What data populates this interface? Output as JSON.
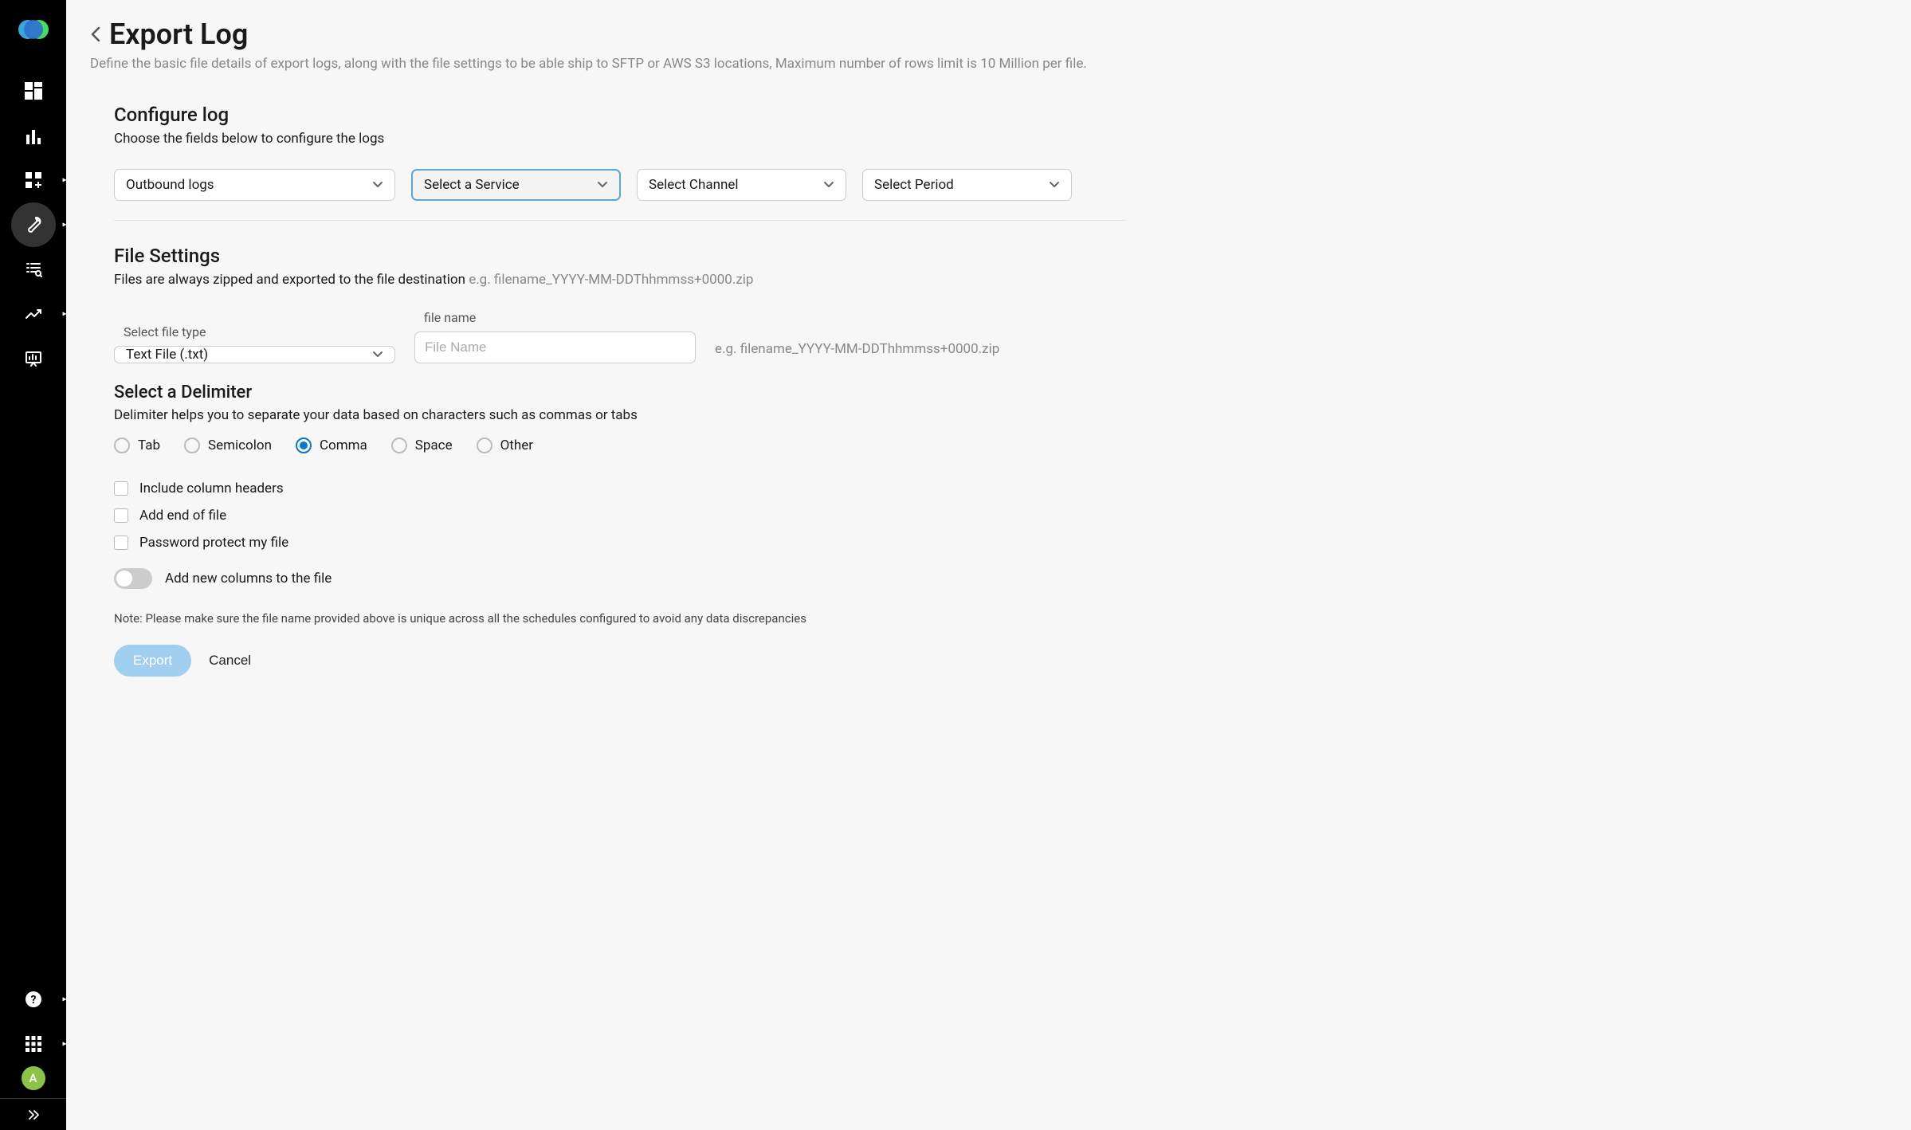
{
  "sidebar": {
    "avatar_letter": "A"
  },
  "header": {
    "title": "Export Log",
    "subtitle": "Define the basic file details of export logs, along with the file settings to be able ship to SFTP or AWS S3 locations, Maximum number of rows limit is 10 Million per file."
  },
  "configure": {
    "title": "Configure log",
    "desc": "Choose the fields below to configure the logs",
    "selects": {
      "log_type": "Outbound logs",
      "service": "Select a Service",
      "channel": "Select Channel",
      "period": "Select Period"
    }
  },
  "file_settings": {
    "title": "File Settings",
    "desc_prefix": "Files are always zipped and exported to the file destination ",
    "desc_example": "e.g. filename_YYYY-MM-DDThhmmss+0000.zip",
    "file_type_label": "Select file type",
    "file_type_value": "Text File (.txt)",
    "file_name_label": "file name",
    "file_name_placeholder": "File Name",
    "file_name_hint": "e.g. filename_YYYY-MM-DDThhmmss+0000.zip"
  },
  "delimiter": {
    "title": "Select a Delimiter",
    "desc": "Delimiter helps you to separate your data based on characters such as commas or tabs",
    "options": [
      "Tab",
      "Semicolon",
      "Comma",
      "Space",
      "Other"
    ],
    "selected": "Comma"
  },
  "checkboxes": {
    "headers": "Include column headers",
    "eof": "Add end of file",
    "password": "Password protect my file"
  },
  "toggle": {
    "label": "Add new columns to the file"
  },
  "note": "Note: Please make sure the file name provided above is unique across all the schedules configured to avoid any data discrepancies",
  "buttons": {
    "export": "Export",
    "cancel": "Cancel"
  }
}
